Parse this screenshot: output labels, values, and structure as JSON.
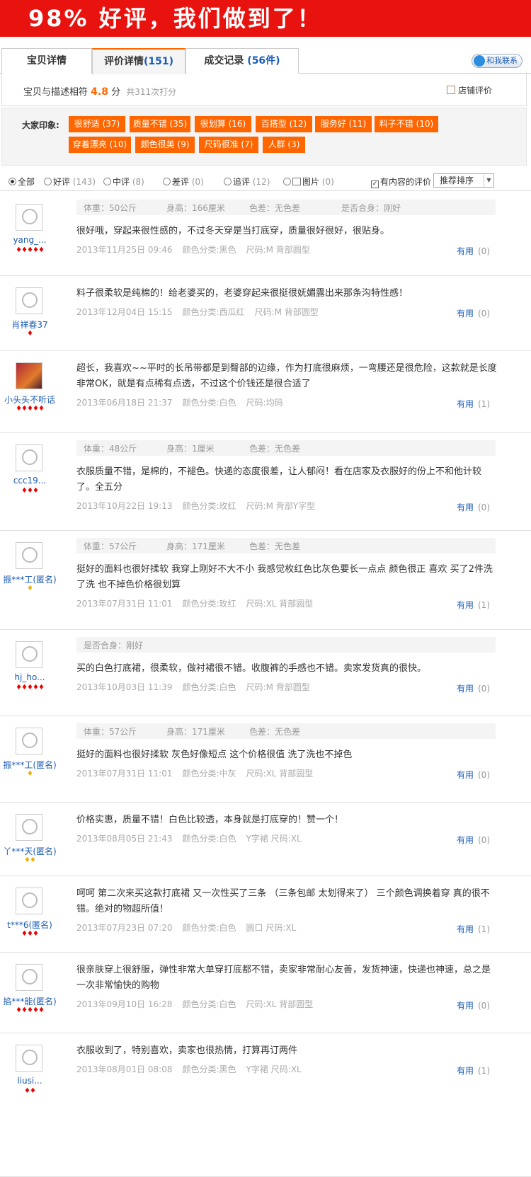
{
  "banner": "98% 好评，我们做到了！",
  "tabs": [
    {
      "label": "宝贝详情"
    },
    {
      "label": "评价详情",
      "count": "(151)"
    },
    {
      "label": "成交记录",
      "count": "(56件)"
    }
  ],
  "contact": "和我联系",
  "score": {
    "label": "宝贝与描述相符",
    "value": "4.8",
    "unit": "分",
    "count": "共311次打分",
    "store": "店铺评价"
  },
  "impression": {
    "title": "大家印象:",
    "tags": [
      "很舒适 (37)",
      "质量不错 (35)",
      "很划算 (16)",
      "百搭型 (12)",
      "服务好 (11)",
      "料子不错 (10)",
      "穿着漂亮 (10)",
      "颜色很美 (9)",
      "尺码很准 (7)",
      "人群 (3)"
    ]
  },
  "filter": {
    "options": [
      {
        "label": "全部",
        "count": ""
      },
      {
        "label": "好评",
        "count": "(143)"
      },
      {
        "label": "中评",
        "count": "(8)"
      },
      {
        "label": "差评",
        "count": "(0)"
      },
      {
        "label": "追评",
        "count": "(12)"
      },
      {
        "label": "图片",
        "count": "(0)"
      }
    ],
    "content_only": "有内容的评价",
    "sort": "推荐排序"
  },
  "useful_label": "有用",
  "reviews": [
    {
      "user": "yang_...",
      "attrs": [
        "体重：50公斤",
        "身高：166厘米",
        "色差：无色差",
        "是否合身：刚好"
      ],
      "text": "很好哦，穿起来很性感的，不过冬天穿是当打底穿，质量很好很好，很贴身。",
      "date": "2013年11月25日 09:46",
      "color": "颜色分类:黑色",
      "size": "尺码:M 背部圆型",
      "useful": "(0)"
    },
    {
      "user": "肖祥春37",
      "attrs": [],
      "text": "料子很柔软是纯棉的！给老婆买的，老婆穿起来很挺很妩媚露出来那条沟特性感！",
      "date": "2013年12月04日 15:15",
      "color": "颜色分类:西瓜红",
      "size": "尺码:M 背部圆型",
      "useful": "(0)"
    },
    {
      "user": "小头头不听话",
      "attrs": [],
      "text": "超长，我喜欢~~平时的长吊带都是到臀部的边缘，作为打底很麻烦，一弯腰还是很危险，这款就是长度非常OK，就是有点稀有点透，不过这个价钱还是很合适了",
      "date": "2013年06月18日 21:37",
      "color": "颜色分类:白色",
      "size": "尺码:均码",
      "useful": "(1)"
    },
    {
      "user": "ccc19...",
      "attrs": [
        "体重：48公斤",
        "身高：1厘米",
        "色差：无色差"
      ],
      "text": "衣服质量不错，是棉的，不褪色。快递的态度很差，让人郁闷！看在店家及衣服好的份上不和他计较了。全五分",
      "date": "2013年10月22日 19:13",
      "color": "颜色分类:玫红",
      "size": "尺码:M 背部Y字型",
      "useful": "(0)"
    },
    {
      "user": "振***工(匿名)",
      "attrs": [
        "体重：57公斤",
        "身高：171厘米",
        "色差：无色差"
      ],
      "text": "挺好的面料也很好揉软 我穿上刚好不大不小 我感觉枚红色比灰色要长一点点 颜色很正 喜欢 买了2件洗了洗 也不掉色价格很划算",
      "date": "2013年07月31日 11:01",
      "color": "颜色分类:玫红",
      "size": "尺码:XL 背部圆型",
      "useful": "(1)"
    },
    {
      "user": "hj_ho...",
      "attrs": [
        "是否合身：刚好"
      ],
      "text": "买的白色打底裙，很柔软，做衬裙很不错。收腹裤的手感也不错。卖家发货真的很快。",
      "date": "2013年10月03日 11:39",
      "color": "颜色分类:白色",
      "size": "尺码:M 背部圆型",
      "useful": "(0)"
    },
    {
      "user": "振***工(匿名)",
      "attrs": [
        "体重：57公斤",
        "身高：171厘米",
        "色差：无色差"
      ],
      "text": "挺好的面料也很好揉软 灰色好像短点 这个价格很值 洗了洗也不掉色",
      "date": "2013年07月31日 11:01",
      "color": "颜色分类:中灰",
      "size": "尺码:XL 背部圆型",
      "useful": "(0)"
    },
    {
      "user": "丫***天(匿名)",
      "attrs": [],
      "text": "价格实惠，质量不错！白色比较透，本身就是打底穿的！赞一个！",
      "date": "2013年08月05日 21:43",
      "color": "颜色分类:白色",
      "size": "Y字裙 尺码:XL",
      "useful": "(0)"
    },
    {
      "user": "t***6(匿名)",
      "attrs": [],
      "text": "呵呵 第二次来买这款打底裙 又一次性买了三条 （三条包邮 太划得来了） 三个颜色调换着穿 真的很不错。绝对的物超所值！",
      "date": "2013年07月23日 07:20",
      "color": "颜色分类:白色",
      "size": "圆口 尺码:XL",
      "useful": "(1)"
    },
    {
      "user": "掐***能(匿名)",
      "attrs": [],
      "text": "很亲肤穿上很舒服，弹性非常大单穿打底都不错，卖家非常耐心友善，发货神速，快递也神速，总之是一次非常愉快的购物",
      "date": "2013年09月10日 16:28",
      "color": "颜色分类:白色",
      "size": "尺码:XL 背部圆型",
      "useful": "(0)"
    },
    {
      "user": "liusi...",
      "attrs": [],
      "text": "衣服收到了，特别喜欢，卖家也很热情，打算再订两件",
      "date": "2013年08月01日 08:08",
      "color": "颜色分类:黑色",
      "size": "Y字裙 尺码:XL",
      "useful": "(1)"
    }
  ]
}
